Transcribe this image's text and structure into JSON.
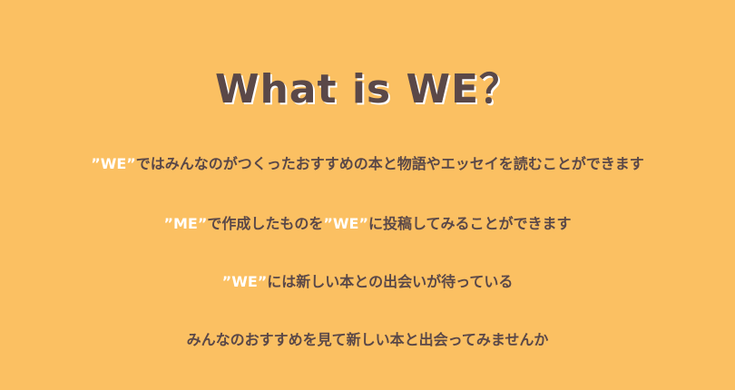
{
  "title": "What is WE？",
  "lines": [
    {
      "hl": "”WE”",
      "rest": "ではみんなのがつくったおすすめの本と物語やエッセイを読むことができます"
    },
    {
      "hl": "”ME”",
      "rest": "で作成したものを",
      "hl2": "”WE”",
      "rest2": "に投稿してみることができます"
    },
    {
      "hl": "”WE”",
      "rest": "には新しい本との出会いが待っている"
    },
    {
      "text": "みんなのおすすめを見て新しい本と出会ってみませんか"
    }
  ],
  "colors": {
    "background": "#fbc062",
    "text": "#5a4848",
    "highlight": "#ffffff"
  }
}
